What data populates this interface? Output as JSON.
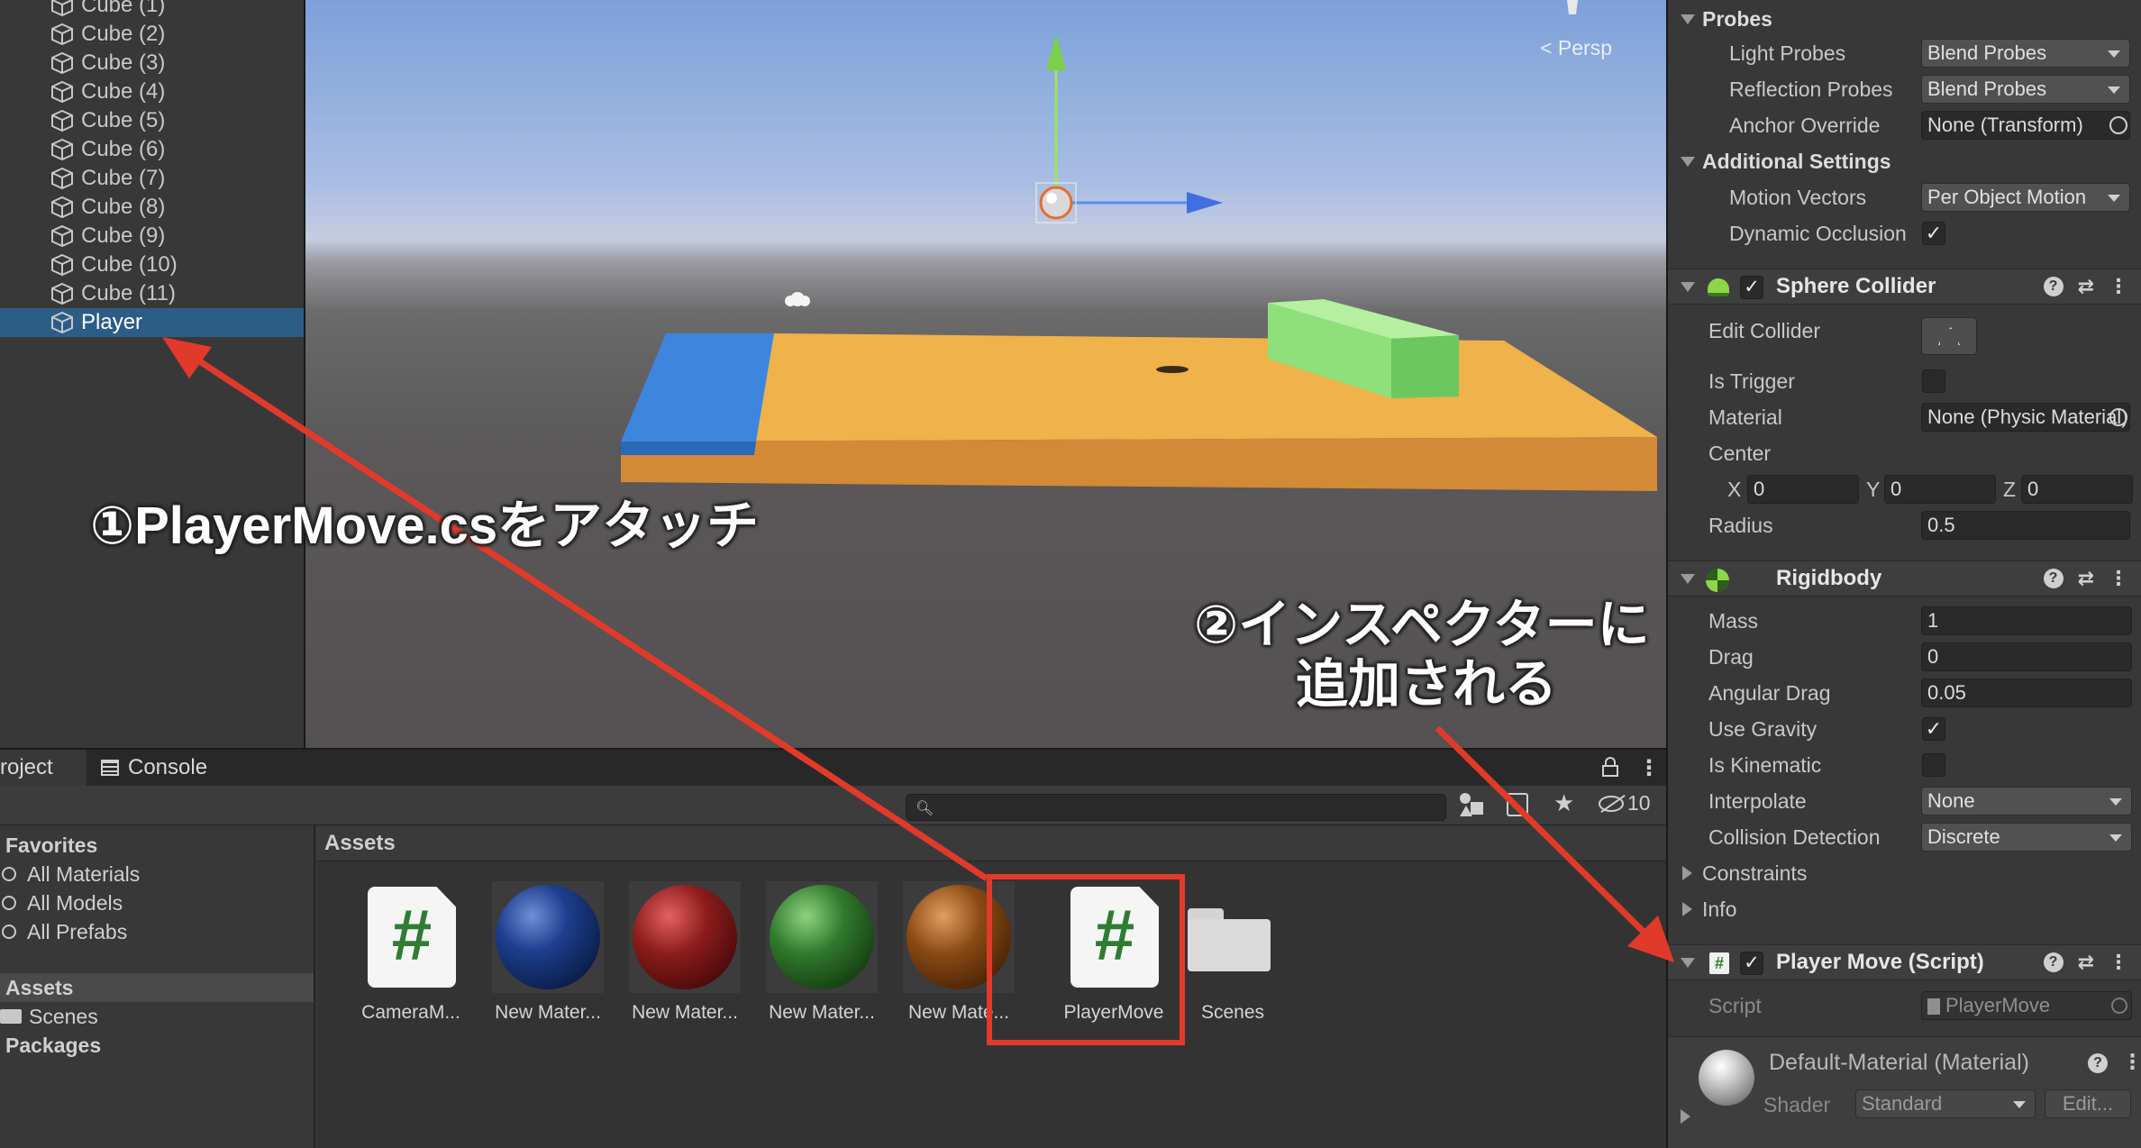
{
  "hierarchy": {
    "items": [
      "Cube (1)",
      "Cube (2)",
      "Cube (3)",
      "Cube (4)",
      "Cube (5)",
      "Cube (6)",
      "Cube (7)",
      "Cube (8)",
      "Cube (9)",
      "Cube (10)",
      "Cube (11)",
      "Player"
    ],
    "selected": "Player"
  },
  "scene": {
    "persp_label": "Persp",
    "persp_icon": "chevron-left-icon"
  },
  "project": {
    "tabs": [
      "roject",
      "Console"
    ],
    "hidden_count": "10",
    "favorites": [
      "Favorites",
      "All Materials",
      "All Models",
      "All Prefabs"
    ],
    "tree": [
      "Assets",
      "Scenes",
      "Packages"
    ],
    "assets_header": "Assets",
    "assets": [
      {
        "label": "CameraM...",
        "kind": "script"
      },
      {
        "label": "New Mater...",
        "kind": "material",
        "color": "#1d3f8f"
      },
      {
        "label": "New Mater...",
        "kind": "material",
        "color": "#8c1c1c"
      },
      {
        "label": "New Mater...",
        "kind": "material",
        "color": "#2f7a2c"
      },
      {
        "label": "New Mate...",
        "kind": "material",
        "color": "#8a4a14"
      },
      {
        "label": "PlayerMove",
        "kind": "script"
      },
      {
        "label": "Scenes",
        "kind": "folder"
      }
    ]
  },
  "inspector": {
    "probes": {
      "title": "Probes",
      "light_probes_label": "Light Probes",
      "light_probes_value": "Blend Probes",
      "reflection_probes_label": "Reflection Probes",
      "reflection_probes_value": "Blend Probes",
      "anchor_override_label": "Anchor Override",
      "anchor_override_value": "None (Transform)"
    },
    "additional": {
      "title": "Additional Settings",
      "motion_vectors_label": "Motion Vectors",
      "motion_vectors_value": "Per Object Motion",
      "dynamic_occlusion_label": "Dynamic Occlusion",
      "dynamic_occlusion_checked": "✓"
    },
    "sphere_collider": {
      "title": "Sphere Collider",
      "edit_collider_label": "Edit Collider",
      "is_trigger_label": "Is Trigger",
      "material_label": "Material",
      "material_value": "None (Physic Material)",
      "center_label": "Center",
      "center": {
        "x_label": "X",
        "x": "0",
        "y_label": "Y",
        "y": "0",
        "z_label": "Z",
        "z": "0"
      },
      "radius_label": "Radius",
      "radius_value": "0.5"
    },
    "rigidbody": {
      "title": "Rigidbody",
      "mass_label": "Mass",
      "mass_value": "1",
      "drag_label": "Drag",
      "drag_value": "0",
      "angular_drag_label": "Angular Drag",
      "angular_drag_value": "0.05",
      "use_gravity_label": "Use Gravity",
      "use_gravity_checked": "✓",
      "is_kinematic_label": "Is Kinematic",
      "interpolate_label": "Interpolate",
      "interpolate_value": "None",
      "collision_label": "Collision Detection",
      "collision_value": "Discrete",
      "constraints_label": "Constraints",
      "info_label": "Info"
    },
    "player_move": {
      "title": "Player Move (Script)",
      "script_label": "Script",
      "script_value": "PlayerMove"
    },
    "material": {
      "title": "Default-Material (Material)",
      "shader_label": "Shader",
      "shader_value": "Standard",
      "edit_label": "Edit..."
    }
  },
  "annotations": {
    "step1": "①PlayerMove.csをアタッチ",
    "step2_line1": "②インスペクターに",
    "step2_line2": "追加される",
    "arrow_color": "#e23a2a"
  }
}
